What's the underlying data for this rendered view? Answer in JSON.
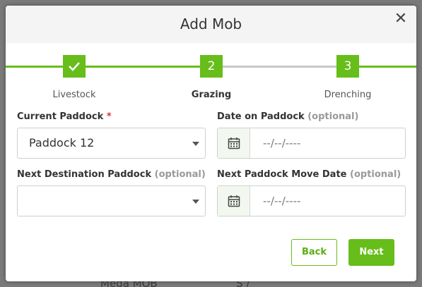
{
  "modal": {
    "title": "Add Mob",
    "close_glyph": "✕"
  },
  "steps": [
    {
      "number": "✓",
      "label": "Livestock",
      "state": "done"
    },
    {
      "number": "2",
      "label": "Grazing",
      "state": "active"
    },
    {
      "number": "3",
      "label": "Drenching",
      "state": "todo"
    }
  ],
  "form": {
    "current_paddock": {
      "label": "Current Paddock",
      "required_mark": "*",
      "value": "Paddock 12"
    },
    "date_on_paddock": {
      "label": "Date on Paddock",
      "optional": "(optional)",
      "value": "--/--/----"
    },
    "next_destination": {
      "label": "Next Destination Paddock",
      "optional": "(optional)",
      "value": ""
    },
    "next_move_date": {
      "label": "Next Paddock Move Date",
      "optional": "(optional)",
      "value": "--/--/----"
    }
  },
  "buttons": {
    "back": "Back",
    "next": "Next"
  },
  "background": {
    "row_text": "Mega MOB",
    "row_value": "S /"
  },
  "colors": {
    "accent": "#67bd1a",
    "header_bg": "#f4f4f4",
    "required": "#dd3333"
  },
  "icons": {
    "calendar": "calendar-icon",
    "caret": "chevron-down-icon",
    "check": "check-icon",
    "close": "close-icon"
  }
}
